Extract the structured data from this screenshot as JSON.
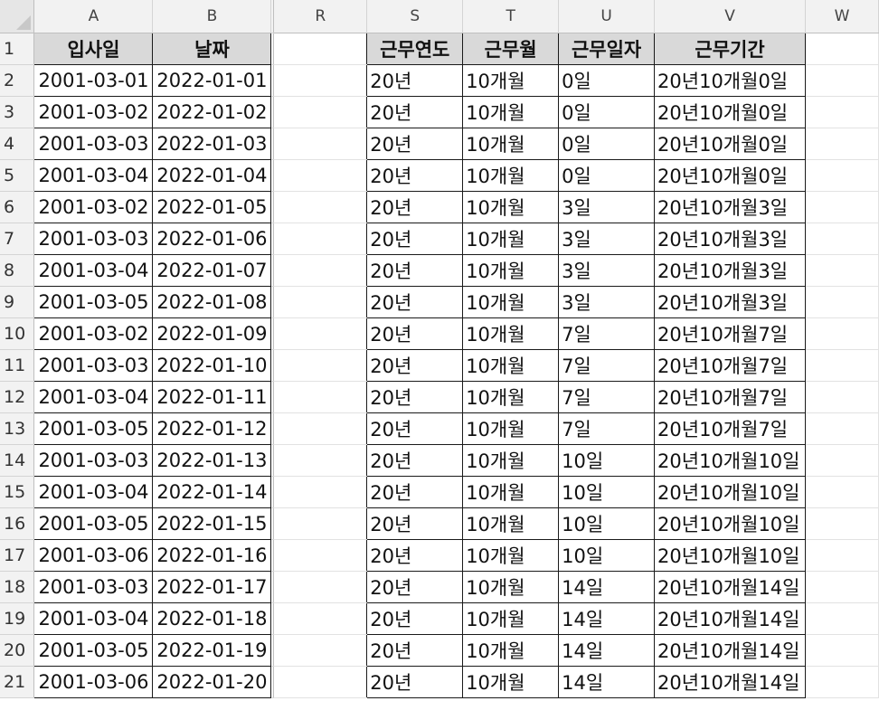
{
  "sheet": {
    "columns": [
      "A",
      "B",
      "R",
      "S",
      "T",
      "U",
      "V",
      "W"
    ],
    "headers": {
      "A": "입사일",
      "B": "날짜",
      "S": "근무연도",
      "T": "근무월",
      "U": "근무일자",
      "V": "근무기간"
    },
    "rows": [
      {
        "num": "2",
        "A": "2001-03-01",
        "B": "2022-01-01",
        "S": "20년",
        "T": "10개월",
        "U": "0일",
        "V": "20년10개월0일"
      },
      {
        "num": "3",
        "A": "2001-03-02",
        "B": "2022-01-02",
        "S": "20년",
        "T": "10개월",
        "U": "0일",
        "V": "20년10개월0일"
      },
      {
        "num": "4",
        "A": "2001-03-03",
        "B": "2022-01-03",
        "S": "20년",
        "T": "10개월",
        "U": "0일",
        "V": "20년10개월0일"
      },
      {
        "num": "5",
        "A": "2001-03-04",
        "B": "2022-01-04",
        "S": "20년",
        "T": "10개월",
        "U": "0일",
        "V": "20년10개월0일"
      },
      {
        "num": "6",
        "A": "2001-03-02",
        "B": "2022-01-05",
        "S": "20년",
        "T": "10개월",
        "U": "3일",
        "V": "20년10개월3일"
      },
      {
        "num": "7",
        "A": "2001-03-03",
        "B": "2022-01-06",
        "S": "20년",
        "T": "10개월",
        "U": "3일",
        "V": "20년10개월3일"
      },
      {
        "num": "8",
        "A": "2001-03-04",
        "B": "2022-01-07",
        "S": "20년",
        "T": "10개월",
        "U": "3일",
        "V": "20년10개월3일"
      },
      {
        "num": "9",
        "A": "2001-03-05",
        "B": "2022-01-08",
        "S": "20년",
        "T": "10개월",
        "U": "3일",
        "V": "20년10개월3일"
      },
      {
        "num": "10",
        "A": "2001-03-02",
        "B": "2022-01-09",
        "S": "20년",
        "T": "10개월",
        "U": "7일",
        "V": "20년10개월7일"
      },
      {
        "num": "11",
        "A": "2001-03-03",
        "B": "2022-01-10",
        "S": "20년",
        "T": "10개월",
        "U": "7일",
        "V": "20년10개월7일"
      },
      {
        "num": "12",
        "A": "2001-03-04",
        "B": "2022-01-11",
        "S": "20년",
        "T": "10개월",
        "U": "7일",
        "V": "20년10개월7일"
      },
      {
        "num": "13",
        "A": "2001-03-05",
        "B": "2022-01-12",
        "S": "20년",
        "T": "10개월",
        "U": "7일",
        "V": "20년10개월7일"
      },
      {
        "num": "14",
        "A": "2001-03-03",
        "B": "2022-01-13",
        "S": "20년",
        "T": "10개월",
        "U": "10일",
        "V": "20년10개월10일"
      },
      {
        "num": "15",
        "A": "2001-03-04",
        "B": "2022-01-14",
        "S": "20년",
        "T": "10개월",
        "U": "10일",
        "V": "20년10개월10일"
      },
      {
        "num": "16",
        "A": "2001-03-05",
        "B": "2022-01-15",
        "S": "20년",
        "T": "10개월",
        "U": "10일",
        "V": "20년10개월10일"
      },
      {
        "num": "17",
        "A": "2001-03-06",
        "B": "2022-01-16",
        "S": "20년",
        "T": "10개월",
        "U": "10일",
        "V": "20년10개월10일"
      },
      {
        "num": "18",
        "A": "2001-03-03",
        "B": "2022-01-17",
        "S": "20년",
        "T": "10개월",
        "U": "14일",
        "V": "20년10개월14일"
      },
      {
        "num": "19",
        "A": "2001-03-04",
        "B": "2022-01-18",
        "S": "20년",
        "T": "10개월",
        "U": "14일",
        "V": "20년10개월14일"
      },
      {
        "num": "20",
        "A": "2001-03-05",
        "B": "2022-01-19",
        "S": "20년",
        "T": "10개월",
        "U": "14일",
        "V": "20년10개월14일"
      },
      {
        "num": "21",
        "A": "2001-03-06",
        "B": "2022-01-20",
        "S": "20년",
        "T": "10개월",
        "U": "14일",
        "V": "20년10개월14일"
      }
    ],
    "header_row_num": "1",
    "header_fill_color": "#d9d9d9",
    "grid_color": "#1a1a1a"
  }
}
